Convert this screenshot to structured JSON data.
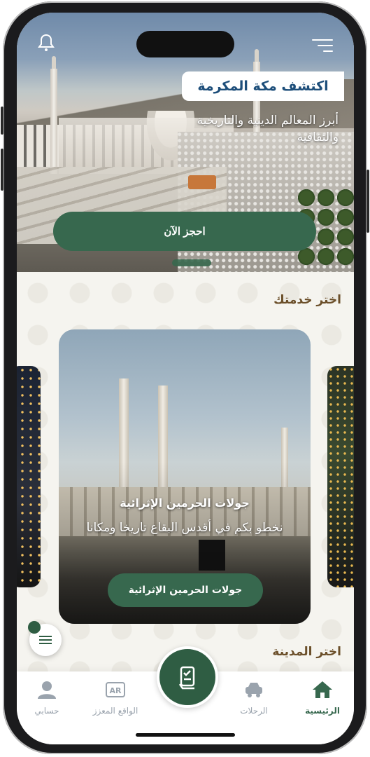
{
  "hero": {
    "title": "اكتشف مكة المكرمة",
    "subtitle": "أبرز المعالم الدينية والتاريخية والثقافية",
    "book_label": "احجز الآن"
  },
  "services": {
    "section_title": "اختر خدمتك",
    "card": {
      "title": "جولات الحرمين الإثرائية",
      "description": "نخطو بكم في أقدس البقاع تاريخا ومكانا",
      "button_label": "جولات الحرمين الإثرائية"
    }
  },
  "city": {
    "section_title": "اختر المدينة"
  },
  "bottom_nav": {
    "items": [
      {
        "label": "الرئيسية",
        "icon": "home-icon",
        "active": true
      },
      {
        "label": "الرحلات",
        "icon": "car-icon",
        "active": false
      },
      {
        "label": "الواقع المعزز",
        "icon": "ar-icon",
        "active": false,
        "icon_text": "AR"
      },
      {
        "label": "حسابي",
        "icon": "user-icon",
        "active": false
      }
    ]
  },
  "colors": {
    "primary": "#37684e",
    "title_blue": "#1d4e7a",
    "section_brown": "#6b4f2a"
  }
}
